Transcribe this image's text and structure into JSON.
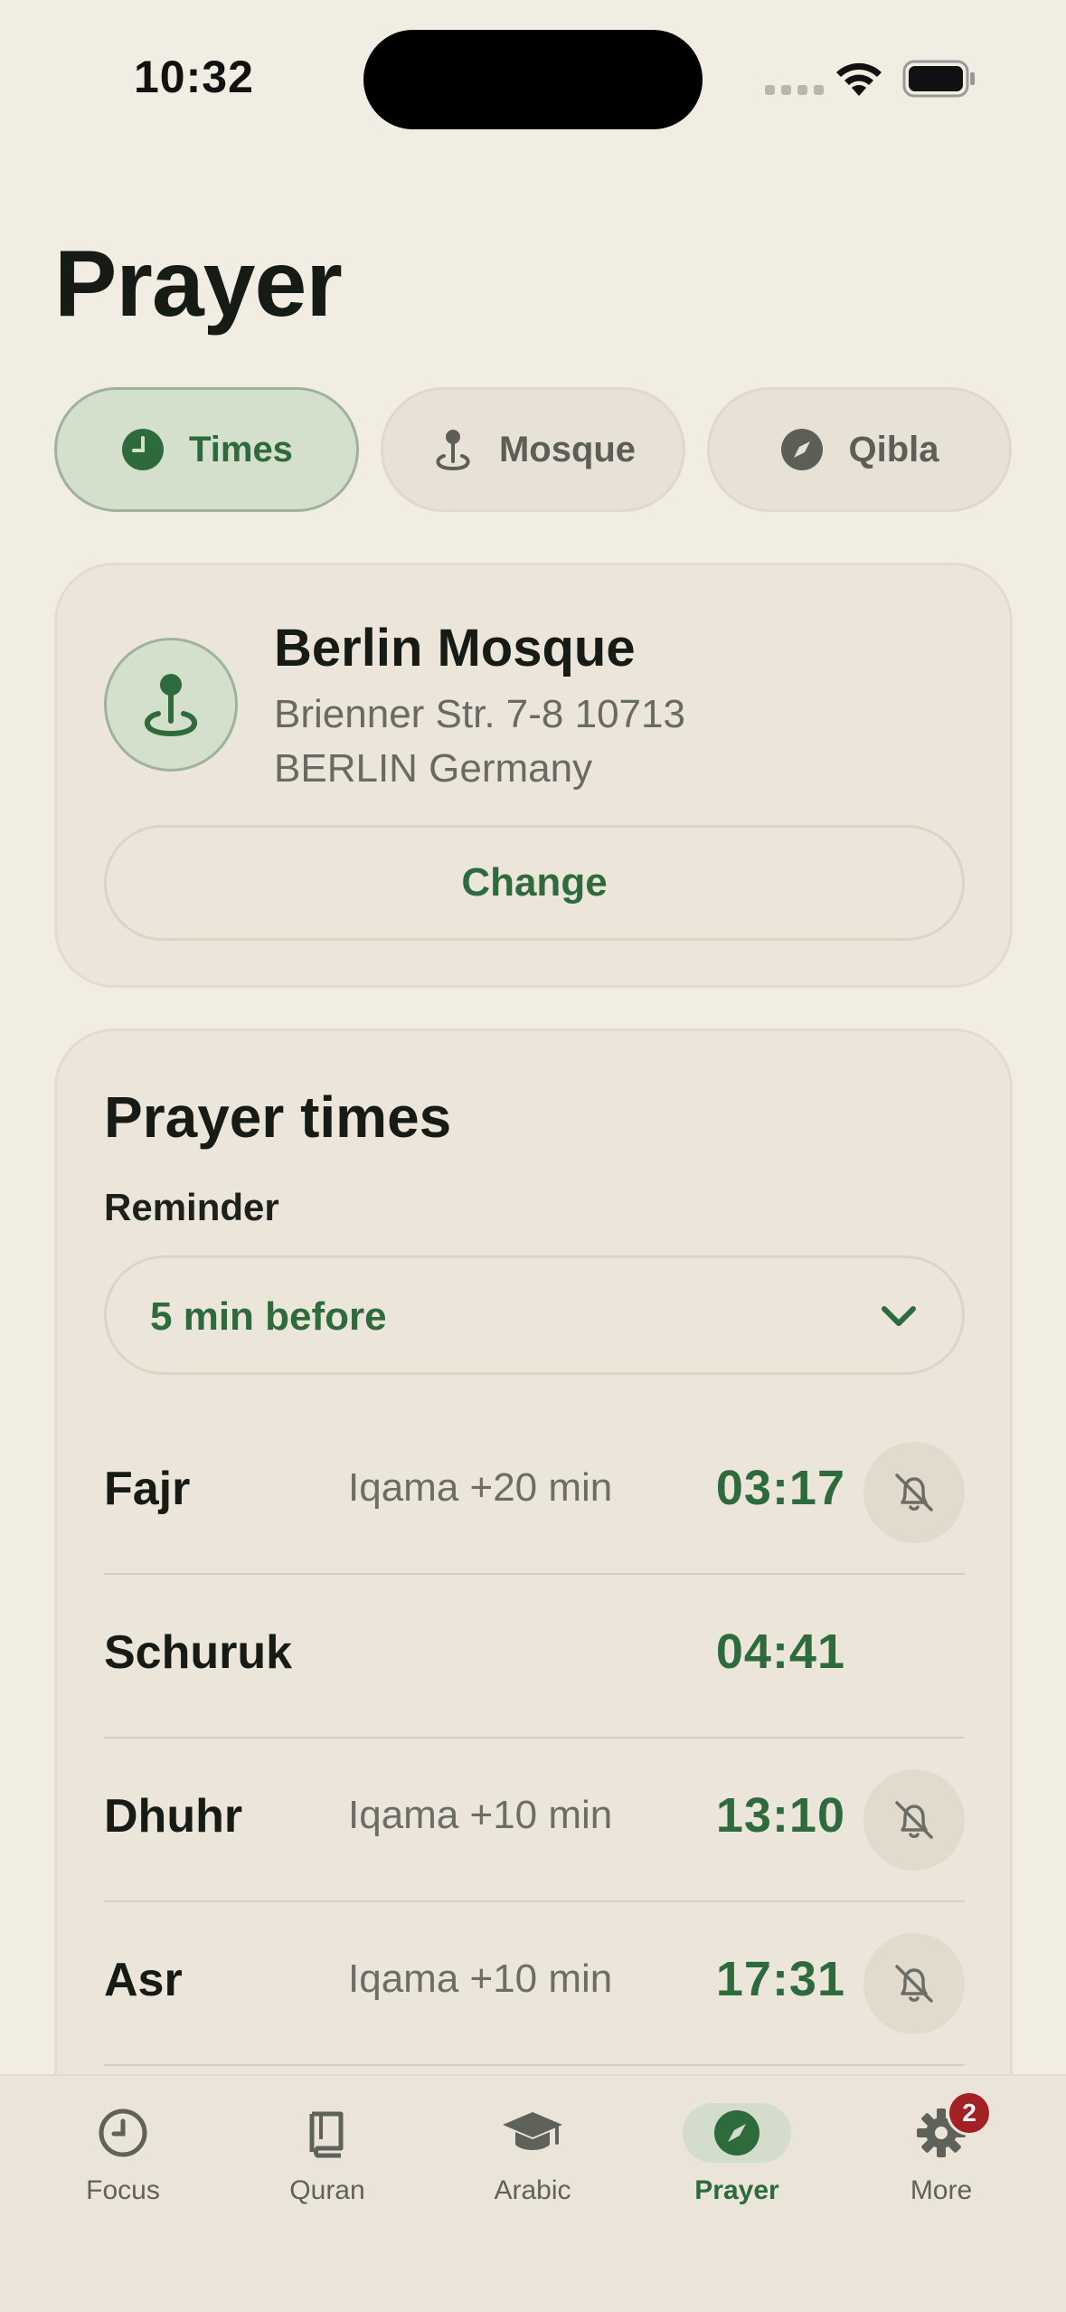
{
  "status_bar": {
    "time": "10:32"
  },
  "page": {
    "title": "Prayer"
  },
  "tabs": [
    {
      "label": "Times",
      "icon": "clock-icon",
      "active": true
    },
    {
      "label": "Mosque",
      "icon": "location-pin-icon",
      "active": false
    },
    {
      "label": "Qibla",
      "icon": "compass-icon",
      "active": false
    }
  ],
  "mosque": {
    "name": "Berlin Mosque",
    "address_line1": "Brienner Str. 7-8 10713",
    "address_line2": "BERLIN Germany",
    "change_label": "Change"
  },
  "prayer_times": {
    "title": "Prayer times",
    "reminder_label": "Reminder",
    "reminder_value": "5 min before",
    "rows": [
      {
        "name": "Fajr",
        "iqama": "Iqama +20 min",
        "time": "03:17",
        "has_bell": true
      },
      {
        "name": "Schuruk",
        "iqama": "",
        "time": "04:41",
        "has_bell": false
      },
      {
        "name": "Dhuhr",
        "iqama": "Iqama +10 min",
        "time": "13:10",
        "has_bell": true
      },
      {
        "name": "Asr",
        "iqama": "Iqama +10 min",
        "time": "17:31",
        "has_bell": true
      }
    ]
  },
  "nav": [
    {
      "label": "Focus",
      "icon": "clock-icon",
      "active": false
    },
    {
      "label": "Quran",
      "icon": "book-icon",
      "active": false
    },
    {
      "label": "Arabic",
      "icon": "graduation-cap-icon",
      "active": false
    },
    {
      "label": "Prayer",
      "icon": "compass-icon",
      "active": true
    },
    {
      "label": "More",
      "icon": "gear-icon",
      "active": false,
      "badge": "2"
    }
  ],
  "colors": {
    "background": "#f1ede3",
    "accent_green": "#2d6a3c",
    "active_tab_bg": "#d4dfcc",
    "badge_red": "#a32024"
  }
}
